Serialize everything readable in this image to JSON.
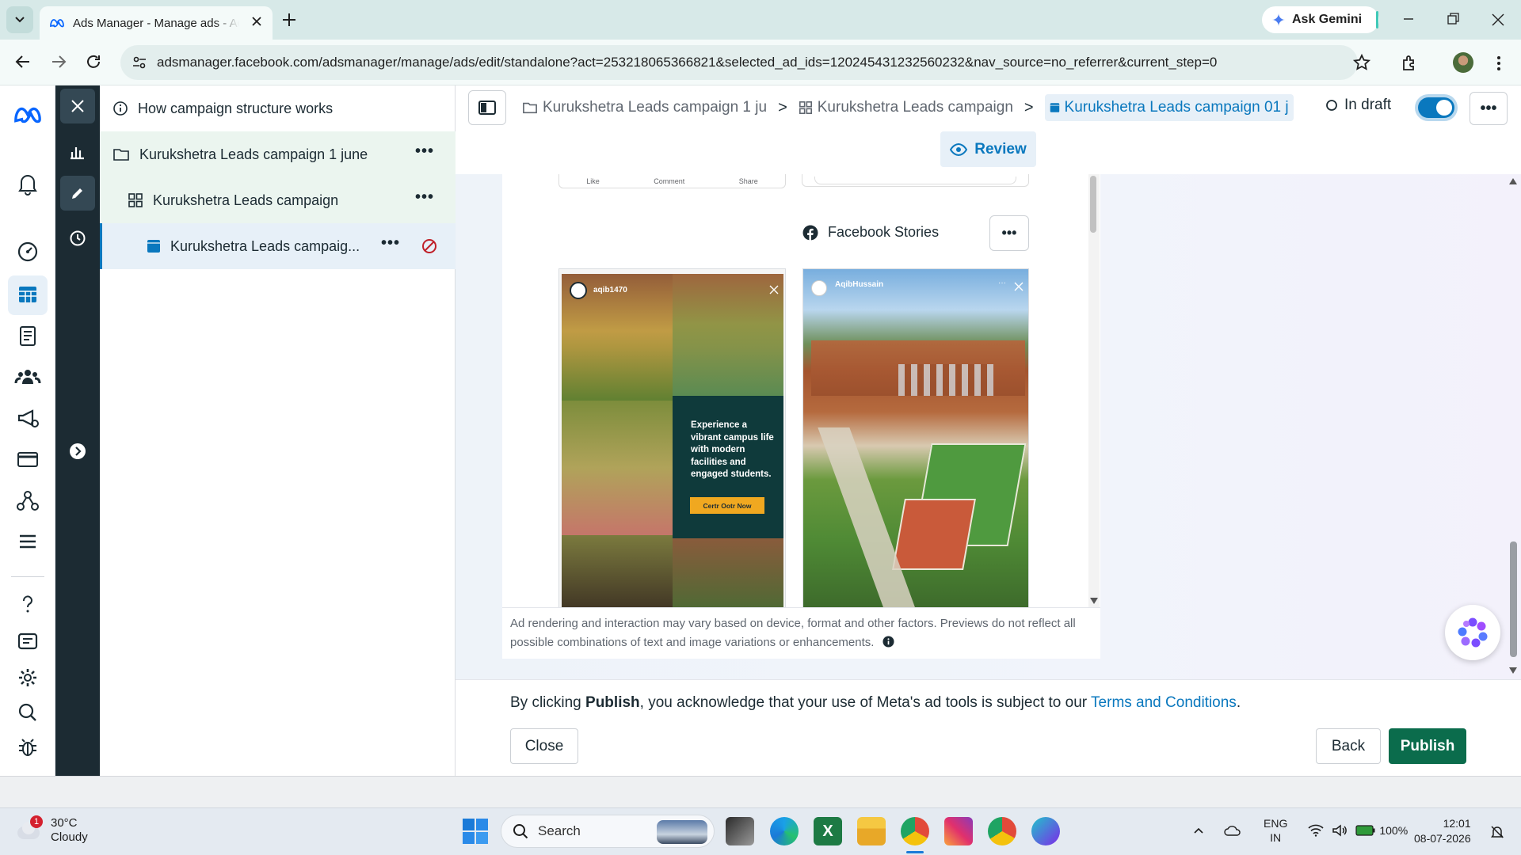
{
  "browser": {
    "tab_title": "Ads Manager - Manage ads - Ad",
    "url": "adsmanager.facebook.com/adsmanager/manage/ads/edit/standalone?act=253218065366821&selected_ad_ids=120245431232560232&nav_source=no_referrer&current_step=0",
    "gemini_label": "Ask Gemini"
  },
  "tree": {
    "info_label": "How campaign structure works",
    "campaign": "Kurukshetra Leads campaign 1 june",
    "adset": "Kurukshetra Leads campaign",
    "ad": "Kurukshetra Leads campaig...",
    "more": "•••"
  },
  "header": {
    "crumb_campaign": "Kurukshetra Leads campaign 1 ju",
    "crumb_adset": "Kurukshetra Leads campaign",
    "crumb_ad": "Kurukshetra Leads campaign 01 j",
    "status": "In draft",
    "more": "•••",
    "review_label": "Review"
  },
  "preview": {
    "post_actions": [
      "Like",
      "Comment",
      "Share"
    ],
    "placement_title": "Facebook Stories",
    "placement_more": "•••",
    "story1": {
      "username": "aqib1470",
      "headline": "Experience a vibrant campus life with modern facilities and engaged students.",
      "cta": "Certr Ootr Now"
    },
    "story2": {
      "username": "AqibHussain"
    },
    "disclaimer": "Ad rendering and interaction may vary based on device, format and other factors. Previews do not reflect all possible combinations of text and image variations or enhancements."
  },
  "footer": {
    "ack_prefix": "By clicking ",
    "ack_bold": "Publish",
    "ack_middle": ", you acknowledge that your use of Meta's ad tools is subject to our ",
    "ack_link": "Terms and Conditions",
    "ack_suffix": ".",
    "close_label": "Close",
    "back_label": "Back",
    "publish_label": "Publish"
  },
  "taskbar": {
    "weather_temp": "30°C",
    "weather_desc": "Cloudy",
    "weather_badge": "1",
    "search_label": "Search",
    "lang_top": "ENG",
    "lang_bottom": "IN",
    "battery": "100%",
    "time": "12:01",
    "date": "08-07-2026"
  },
  "colors": {
    "meta_blue": "#0a78be",
    "publish_green": "#0b6c4c",
    "nav_dark": "#1c2b33"
  }
}
